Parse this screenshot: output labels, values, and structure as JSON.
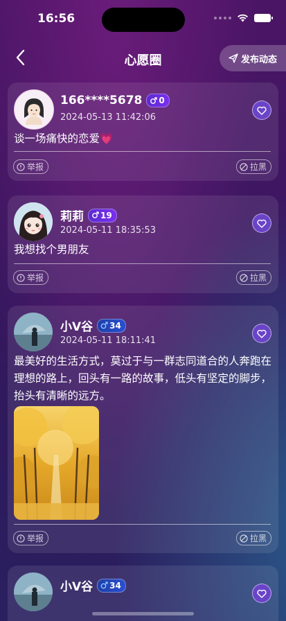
{
  "status_bar": {
    "time": "16:56"
  },
  "nav": {
    "title": "心愿圈",
    "post_button": "发布动态"
  },
  "actions": {
    "report": "举报",
    "block": "拉黑"
  },
  "posts": [
    {
      "name": "166****5678",
      "badge": "0",
      "date": "2024-05-13 11:42:06",
      "content": "谈一场痛快的恋爱💗"
    },
    {
      "name": "莉莉",
      "badge": "19",
      "date": "2024-05-11 18:35:53",
      "content": "我想找个男朋友"
    },
    {
      "name": "小V谷",
      "badge": "34",
      "date": "2024-05-11 18:11:41",
      "content": "最美好的生活方式，莫过于与一群志同道合的人奔跑在理想的路上，回头有一路的故事，低头有坚定的脚步，抬头有清晰的远方。"
    },
    {
      "name": "小V谷",
      "badge": "34"
    }
  ]
}
